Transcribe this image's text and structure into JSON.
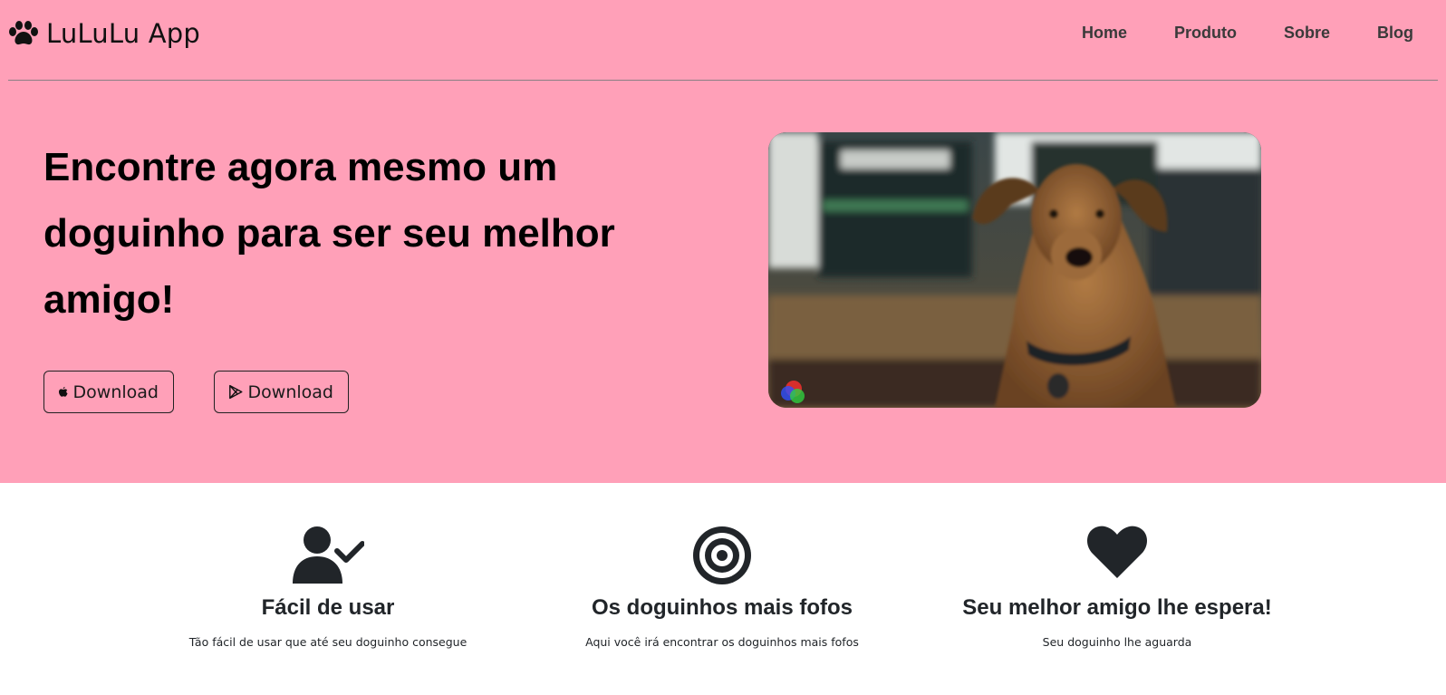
{
  "brand": {
    "name": "LuLuLu App",
    "icon": "paw-icon"
  },
  "nav": {
    "items": [
      {
        "label": "Home"
      },
      {
        "label": "Produto"
      },
      {
        "label": "Sobre"
      },
      {
        "label": "Blog"
      }
    ]
  },
  "hero": {
    "headline": "Encontre agora mesmo um doguinho para ser seu melhor amigo!",
    "buttons": [
      {
        "label": "Download",
        "icon": "apple-icon"
      },
      {
        "label": "Download",
        "icon": "google-play-icon"
      }
    ],
    "image": "dog-photo"
  },
  "features": [
    {
      "icon": "user-check-icon",
      "title": "Fácil de usar",
      "text": "Tão fácil de usar que até seu doguinho consegue"
    },
    {
      "icon": "target-icon",
      "title": "Os doguinhos mais fofos",
      "text": "Aqui você irá encontrar os doguinhos mais fofos"
    },
    {
      "icon": "heart-icon",
      "title": "Seu melhor amigo lhe espera!",
      "text": "Seu doguinho lhe aguarda"
    }
  ],
  "colors": {
    "hero_bg": "#ffa0b8",
    "text_dark": "#212529",
    "page_bg": "#ffffff"
  }
}
